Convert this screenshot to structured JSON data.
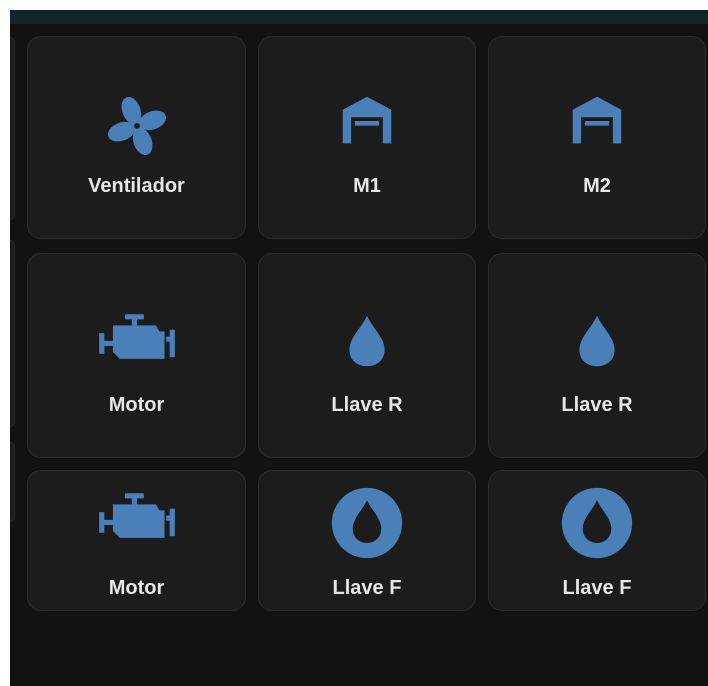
{
  "theme": {
    "background": "#121212",
    "tile_background": "#1c1c1c",
    "tile_border": "#2c2c2c",
    "icon_color": "#4a7fb8",
    "label_color": "#e6e6e6"
  },
  "tiles": [
    {
      "label": "Ventilador",
      "icon": "fan-icon"
    },
    {
      "label": "M1",
      "icon": "garage-icon"
    },
    {
      "label": "M2",
      "icon": "garage-icon"
    },
    {
      "label": "Motor",
      "icon": "engine-icon"
    },
    {
      "label": "Llave R",
      "icon": "water-drop-icon"
    },
    {
      "label": "Llave R",
      "icon": "water-drop-icon"
    },
    {
      "label": "Motor",
      "icon": "engine-icon"
    },
    {
      "label": "Llave F",
      "icon": "water-ring-icon"
    },
    {
      "label": "Llave F",
      "icon": "water-ring-icon"
    }
  ]
}
